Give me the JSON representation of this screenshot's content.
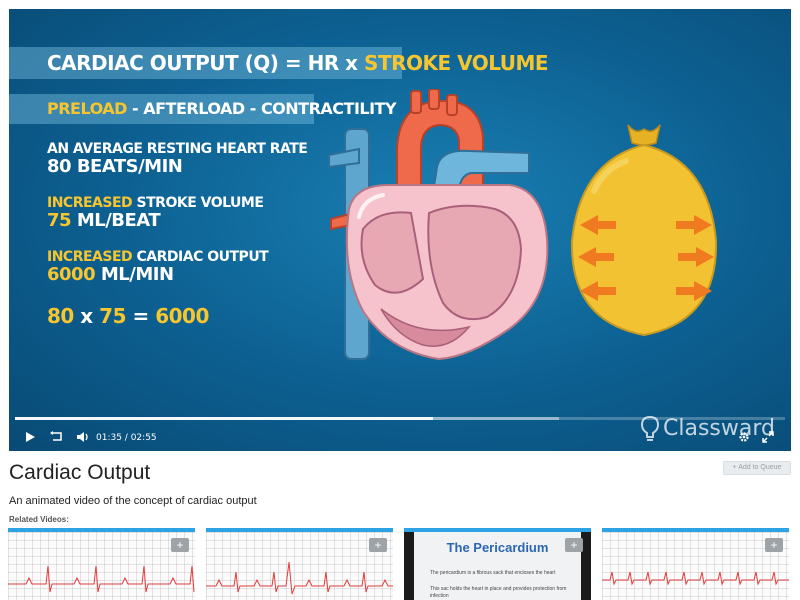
{
  "slide": {
    "formula_prefix": "CARDIAC OUTPUT (Q) = HR x ",
    "formula_highlight": "STROKE VOLUME",
    "factors_highlight": "PRELOAD",
    "factors_rest": " - AFTERLOAD - CONTRACTILITY",
    "hr_line1": "AN AVERAGE RESTING HEART RATE",
    "hr_line2": "80 BEATS/MIN",
    "sv_highlight": "INCREASED",
    "sv_rest": " STROKE VOLUME",
    "sv_value_num": "75",
    "sv_value_unit": " ML/BEAT",
    "co_highlight": "INCREASED",
    "co_rest": " CARDIAC OUTPUT",
    "co_value_num": "6000",
    "co_value_unit": " ML/MIN",
    "eq_a": "80",
    "eq_x": " x ",
    "eq_b": "75",
    "eq_eq": " = ",
    "eq_c": "6000"
  },
  "player": {
    "current_time": "01:35",
    "separator": " / ",
    "duration": "02:55",
    "progress_fraction": 0.543,
    "buffered_fraction": 0.706,
    "brand": "Classward"
  },
  "page": {
    "title": "Cardiac Output",
    "add_to_queue": "+ Add to Queue",
    "description": "An animated video of the concept of cardiac output",
    "related_label": "Related Videos:"
  },
  "related": [
    {
      "plus": "+"
    },
    {
      "plus": "+"
    },
    {
      "plus": "+",
      "title": "The Pericardium",
      "bullets": [
        "The pericardium is a fibrous sack that encloses the heart",
        "This sac holds the heart in place and provides protection from infection"
      ]
    },
    {
      "plus": "+"
    }
  ],
  "colors": {
    "accent": "#2da3e3",
    "highlight": "#f7c62f",
    "background": "#0c5f90"
  }
}
